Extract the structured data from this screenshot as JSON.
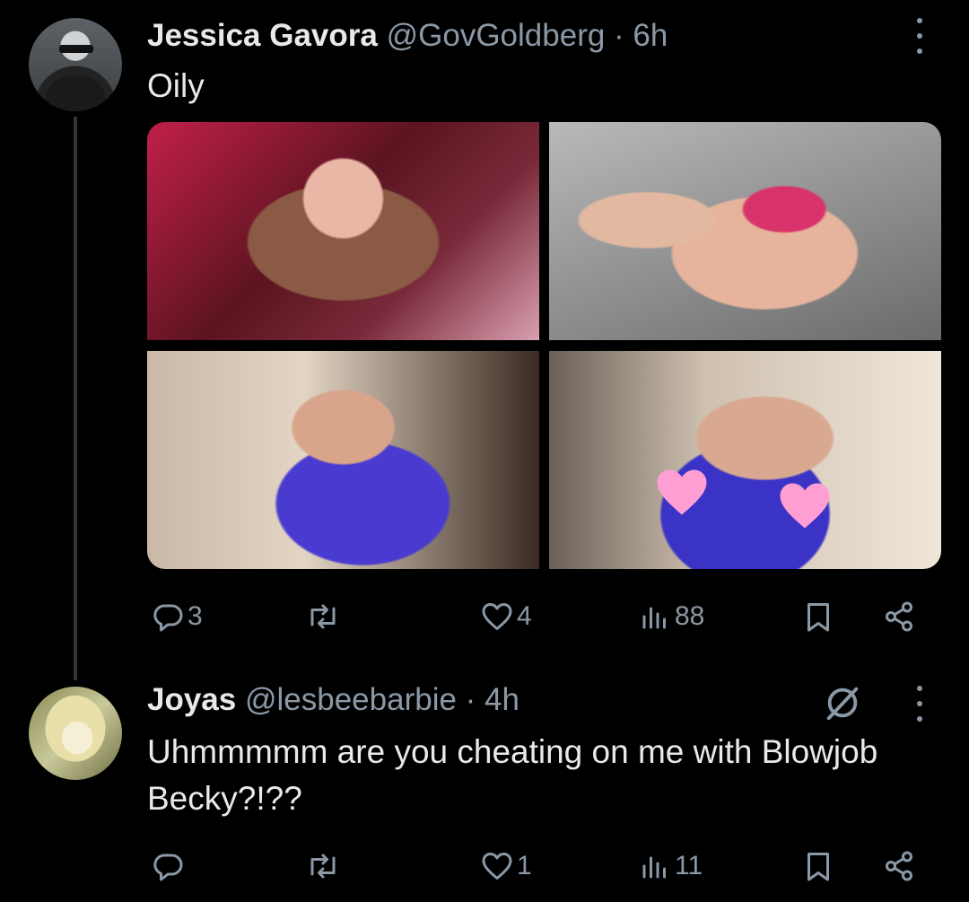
{
  "tweets": [
    {
      "author_name": "Jessica Gavora",
      "meta": "@GovGoldberg · 6h",
      "text": "Oily",
      "media_count": 4,
      "replies": "3",
      "retweets": "",
      "likes": "4",
      "views": "88",
      "avatar_icon": "avatar-2b-android",
      "more_icon": "more-vertical-icon"
    },
    {
      "author_name": "Joyas",
      "meta": "@lesbeebarbie · 4h",
      "text": "Uhmmmmm are you cheating on me with Blowjob Becky?!??",
      "replies": "",
      "retweets": "",
      "likes": "1",
      "views": "11",
      "grok_icon": "grok-slash-icon",
      "more_icon": "more-vertical-icon"
    }
  ],
  "colors": {
    "background": "#000000",
    "text_primary": "#e7e9ea",
    "text_secondary": "#8b98a5",
    "thread_line": "#333639",
    "censor_heart": "#ff9ed2"
  }
}
